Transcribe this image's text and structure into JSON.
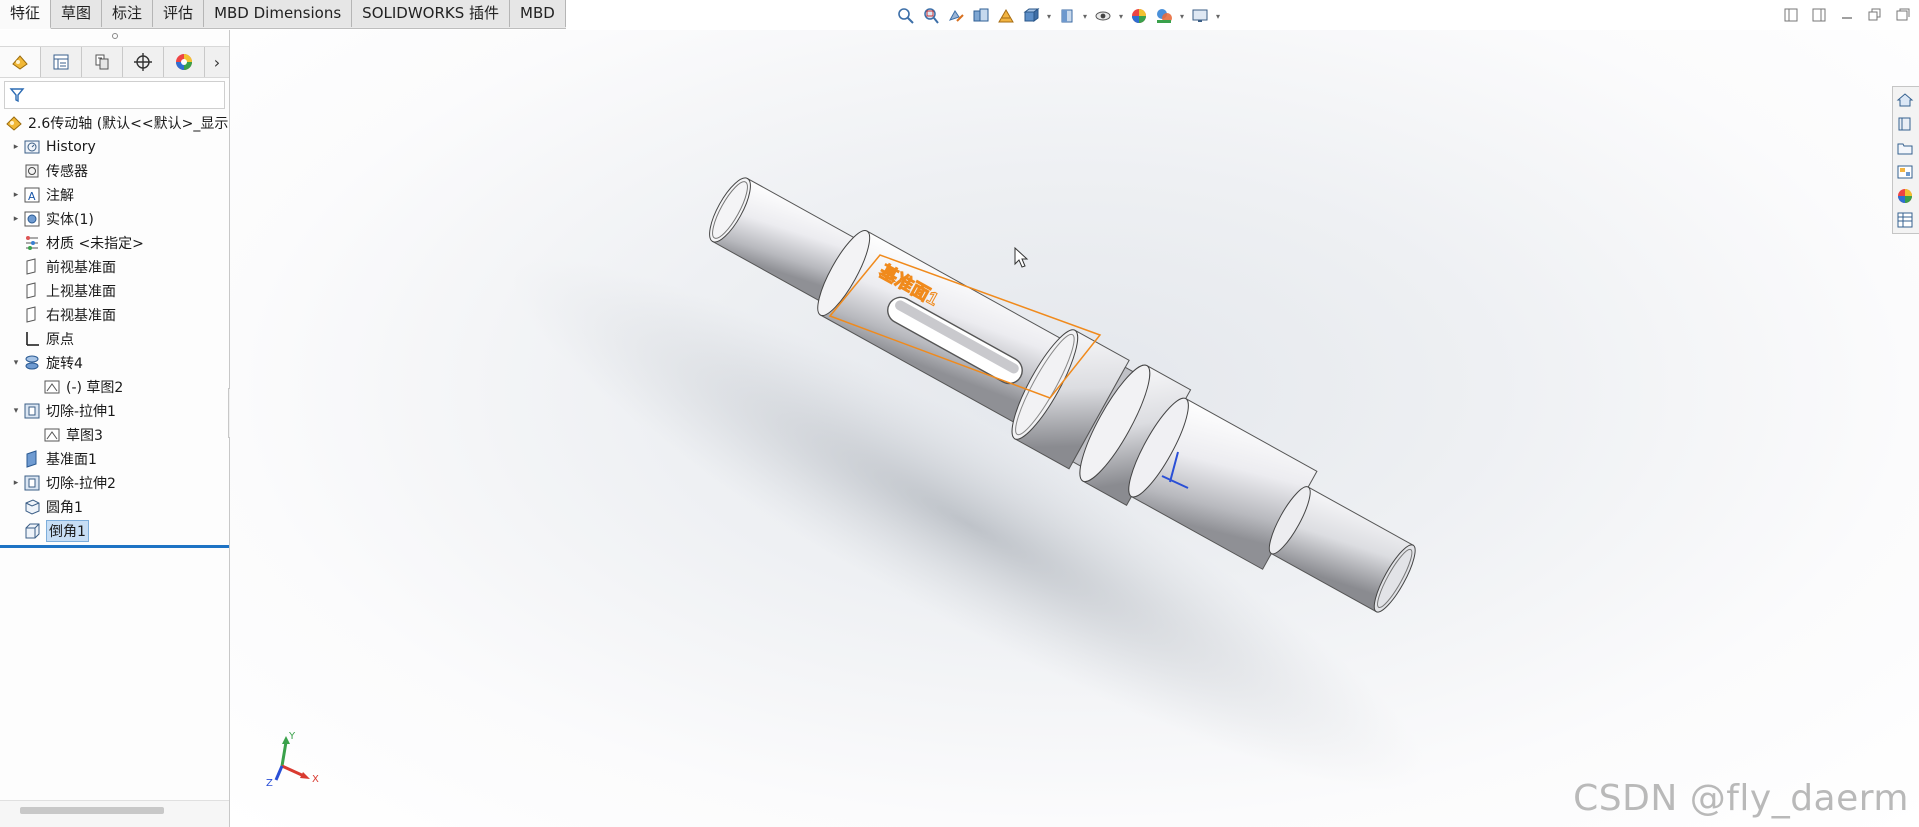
{
  "tabs": [
    {
      "label": "特征",
      "active": true
    },
    {
      "label": "草图",
      "active": false
    },
    {
      "label": "标注",
      "active": false
    },
    {
      "label": "评估",
      "active": false
    },
    {
      "label": "MBD Dimensions",
      "active": false
    },
    {
      "label": "SOLIDWORKS 插件",
      "active": false
    },
    {
      "label": "MBD",
      "active": false
    }
  ],
  "heads_up_toolbar": [
    "zoom-to-fit-icon",
    "zoom-to-area-icon",
    "previous-view-icon",
    "section-view-icon",
    "dynamic-annotation-icon",
    "view-orientation-icon",
    "display-style-icon",
    "hide-show-icon",
    "edit-appearance-icon",
    "apply-scene-icon",
    "view-settings-icon"
  ],
  "manager_tabs": [
    "feature-manager-icon",
    "property-manager-icon",
    "configuration-manager-icon",
    "dimxpert-manager-icon",
    "display-manager-icon"
  ],
  "tree": {
    "root": "2.6传动轴  (默认<<默认>_显示",
    "items": [
      {
        "label": "History",
        "expand": "right",
        "icon": "history-folder-icon",
        "indent": 0
      },
      {
        "label": "传感器",
        "expand": "",
        "icon": "sensor-icon",
        "indent": 0
      },
      {
        "label": "注解",
        "expand": "right",
        "icon": "annotation-icon",
        "indent": 0
      },
      {
        "label": "实体(1)",
        "expand": "right",
        "icon": "solid-bodies-icon",
        "indent": 0
      },
      {
        "label": "材质 <未指定>",
        "expand": "",
        "icon": "material-icon",
        "indent": 0
      },
      {
        "label": "前视基准面",
        "expand": "",
        "icon": "plane-icon",
        "indent": 0
      },
      {
        "label": "上视基准面",
        "expand": "",
        "icon": "plane-icon",
        "indent": 0
      },
      {
        "label": "右视基准面",
        "expand": "",
        "icon": "plane-icon",
        "indent": 0
      },
      {
        "label": "原点",
        "expand": "",
        "icon": "origin-icon",
        "indent": 0
      },
      {
        "label": "旋转4",
        "expand": "down",
        "icon": "revolve-icon",
        "indent": 0
      },
      {
        "label": "(-) 草图2",
        "expand": "",
        "icon": "sketch-icon",
        "indent": 1
      },
      {
        "label": "切除-拉伸1",
        "expand": "down",
        "icon": "cut-extrude-icon",
        "indent": 0
      },
      {
        "label": "草图3",
        "expand": "",
        "icon": "sketch-icon",
        "indent": 1
      },
      {
        "label": "基准面1",
        "expand": "",
        "icon": "ref-plane-icon",
        "indent": 0
      },
      {
        "label": "切除-拉伸2",
        "expand": "right",
        "icon": "cut-extrude-icon",
        "indent": 0
      },
      {
        "label": "圆角1",
        "expand": "",
        "icon": "fillet-icon",
        "indent": 0
      },
      {
        "label": "倒角1",
        "expand": "",
        "icon": "chamfer-icon",
        "indent": 0,
        "selected": true
      }
    ]
  },
  "viewport": {
    "plane_label": "基准面1",
    "triad": {
      "x": "X",
      "y": "Y",
      "z": "Z"
    },
    "watermark": "CSDN @fly_daerm",
    "accent_color": "#f08a1c"
  },
  "task_pane": [
    "home-icon",
    "design-library-icon",
    "file-explorer-icon",
    "view-palette-icon",
    "appearances-icon",
    "custom-properties-icon"
  ]
}
